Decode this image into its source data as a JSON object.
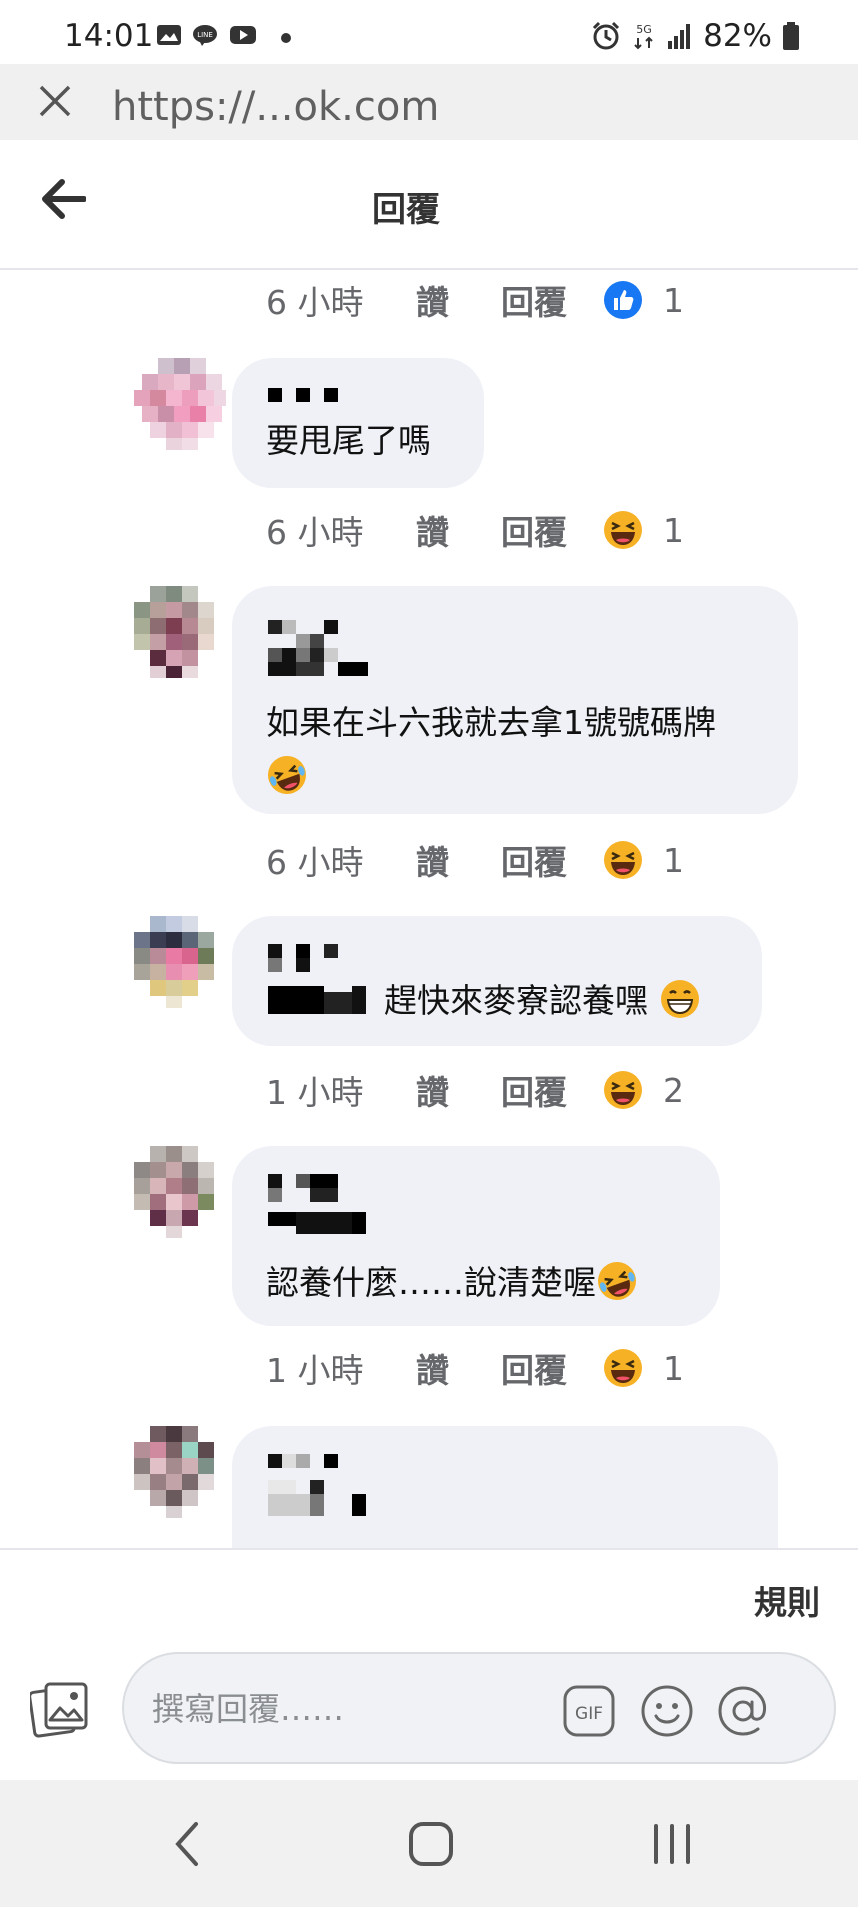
{
  "status_bar": {
    "time": "14:01",
    "network": "5G",
    "battery": "82%"
  },
  "browser": {
    "url": "https://...ok.com"
  },
  "header": {
    "title": "回覆"
  },
  "meta_rows": [
    {
      "time": "6 小時",
      "like": "讚",
      "reply": "回覆",
      "reaction": "like",
      "count": "1"
    },
    {
      "time": "6 小時",
      "like": "讚",
      "reply": "回覆",
      "reaction": "haha",
      "count": "1"
    },
    {
      "time": "6 小時",
      "like": "讚",
      "reply": "回覆",
      "reaction": "haha",
      "count": "1"
    },
    {
      "time": "1 小時",
      "like": "讚",
      "reply": "回覆",
      "reaction": "haha",
      "count": "2"
    },
    {
      "time": "1 小時",
      "like": "讚",
      "reply": "回覆",
      "reaction": "haha",
      "count": "1"
    }
  ],
  "comments": [
    {
      "text": "要甩尾了嗎"
    },
    {
      "text_line1": "如果在斗六我就去拿1號號碼牌",
      "emoji": "rofl"
    },
    {
      "text": "趕快來麥寮認養嘿",
      "emoji": "grin"
    },
    {
      "text": "認養什麼……說清楚喔",
      "emoji": "rofl"
    },
    {
      "text": ""
    }
  ],
  "footer": {
    "rules": "規則",
    "placeholder": "撰寫回覆……",
    "gif_label": "GIF"
  }
}
